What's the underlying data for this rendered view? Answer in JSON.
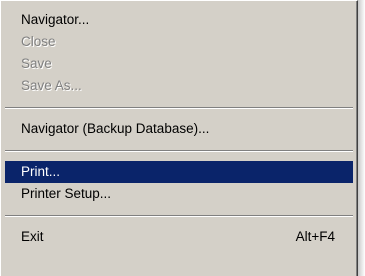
{
  "menu": {
    "items": [
      {
        "label": "Navigator...",
        "enabled": true
      },
      {
        "label": "Close",
        "enabled": false
      },
      {
        "label": "Save",
        "enabled": false
      },
      {
        "label": "Save As...",
        "enabled": false
      },
      {
        "label": "Navigator (Backup Database)...",
        "enabled": true
      },
      {
        "label": "Print...",
        "enabled": true,
        "selected": true
      },
      {
        "label": "Printer Setup...",
        "enabled": true
      },
      {
        "label": "Exit",
        "enabled": true,
        "shortcut": "Alt+F4"
      }
    ]
  },
  "colors": {
    "menu_background": "#d4d0c8",
    "highlight": "#0a246a",
    "highlight_text": "#ffffff",
    "disabled_text": "#808080"
  }
}
